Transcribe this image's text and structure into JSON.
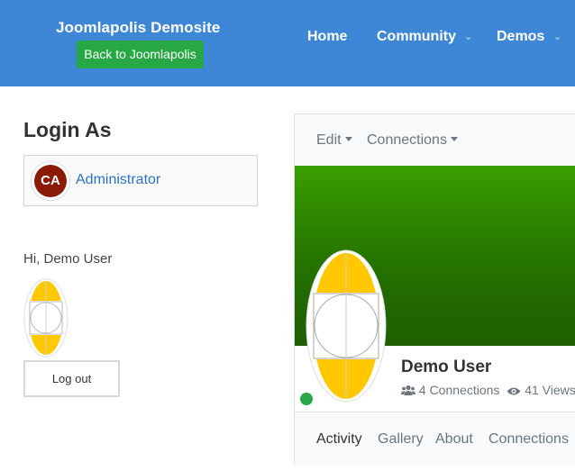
{
  "header": {
    "site_title": "Joomlapolis Demosite",
    "back_button": "Back to Joomlapolis",
    "nav": [
      {
        "label": "Home",
        "has_caret": false
      },
      {
        "label": "Community",
        "has_caret": true
      },
      {
        "label": "Demos",
        "has_caret": true
      }
    ],
    "colors": {
      "bar": "#3d87d6",
      "back_button": "#28a745"
    }
  },
  "login_as": {
    "title": "Login As",
    "admin_initials": "CA",
    "admin_name": "Administrator",
    "avatar_color": "#8b1b06"
  },
  "user_module": {
    "greeting": "Hi, Demo User",
    "logout_label": "Log out"
  },
  "profile": {
    "toolbar": [
      "Edit",
      "Connections"
    ],
    "name": "Demo User",
    "connections": "4 Connections",
    "views": "41 Views",
    "online": true,
    "tabs": [
      "Activity",
      "Gallery",
      "About",
      "Connections"
    ],
    "active_tab": "Activity",
    "colors": {
      "cover_top": "#3a9e00",
      "cover_bottom": "#1e5e00",
      "online": "#28a745",
      "avatar_fill": "#ffc800"
    }
  }
}
